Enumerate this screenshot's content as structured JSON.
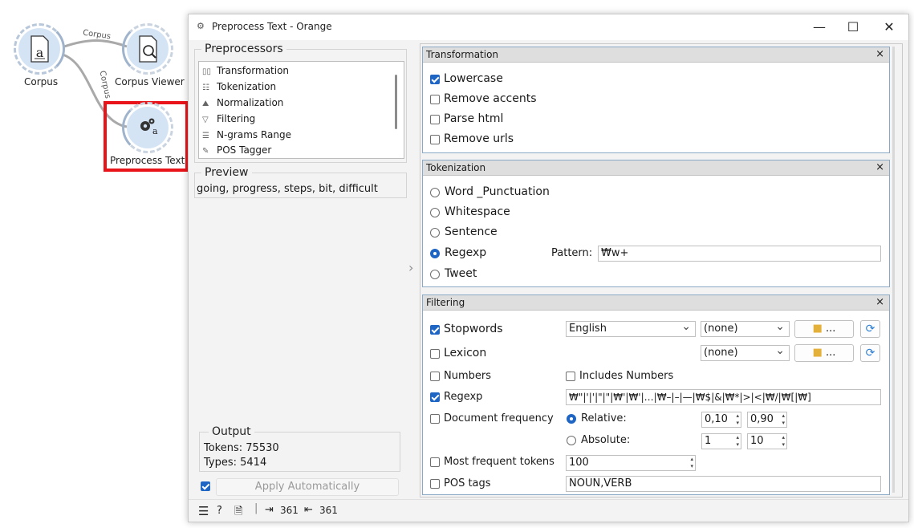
{
  "canvas": {
    "corpus_label": "Corpus",
    "corpus_viewer_label": "Corpus Viewer",
    "preprocess_label": "Preprocess Text",
    "link_label_1": "Corpus",
    "link_label_2": "Corpus",
    "highlight_color": "#e8141a"
  },
  "window": {
    "title": "Preprocess Text - Orange",
    "minimize": "—",
    "maximize": "☐",
    "close": "✕"
  },
  "left": {
    "preprocessors_title": "Preprocessors",
    "preprocessors": [
      {
        "icon": "transformation-icon",
        "label": "Transformation"
      },
      {
        "icon": "tokenization-icon",
        "label": "Tokenization"
      },
      {
        "icon": "normalization-icon",
        "label": "Normalization"
      },
      {
        "icon": "filtering-icon",
        "label": "Filtering"
      },
      {
        "icon": "ngrams-icon",
        "label": "N-grams Range"
      },
      {
        "icon": "pos-tagger-icon",
        "label": "POS Tagger"
      }
    ],
    "preview_title": "Preview",
    "preview_text": "going, progress, steps, bit, difficult",
    "output_title": "Output",
    "tokens": "Tokens: 75530",
    "types": "Types: 5414",
    "apply_label": "Apply Automatically"
  },
  "transformation": {
    "title": "Transformation",
    "close": "×",
    "lowercase": "Lowercase",
    "remove_accents": "Remove accents",
    "parse_html": "Parse html",
    "remove_urls": "Remove urls"
  },
  "tokenization": {
    "title": "Tokenization",
    "close": "×",
    "word_punct": "Word _Punctuation",
    "whitespace": "Whitespace",
    "sentence": "Sentence",
    "regexp": "Regexp",
    "tweet": "Tweet",
    "pattern_label": "Pattern:",
    "pattern_value": "₩w+"
  },
  "filtering": {
    "title": "Filtering",
    "close": "×",
    "stopwords": "Stopwords",
    "stopwords_lang": "English",
    "stopwords_file": "(none)",
    "lexicon": "Lexicon",
    "lexicon_file": "(none)",
    "browse": "...",
    "numbers": "Numbers",
    "includes_numbers": "Includes Numbers",
    "regexp": "Regexp",
    "regexp_value": "₩\"|'|'|\"|\"|₩'|₩'|…|₩–|–|—|₩$|&|₩*|>|<|₩/|₩[|₩]",
    "doc_freq": "Document frequency",
    "relative": "Relative:",
    "rel_min": "0,10",
    "rel_max": "0,90",
    "absolute": "Absolute:",
    "abs_min": "1",
    "abs_max": "10",
    "most_frequent": "Most frequent tokens",
    "most_frequent_value": "100",
    "pos_tags": "POS tags",
    "pos_tags_value": "NOUN,VERB"
  },
  "statusbar": {
    "input_count": "361",
    "output_count": "361"
  }
}
